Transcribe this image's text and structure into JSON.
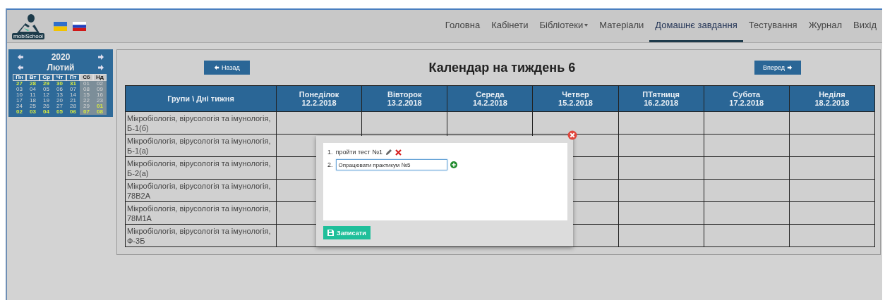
{
  "header": {
    "logo_text": "mobiSchool",
    "nav": [
      {
        "label": "Головна",
        "selected": false,
        "dropdown": false
      },
      {
        "label": "Кабінети",
        "selected": false,
        "dropdown": false
      },
      {
        "label": "Бібліотеки",
        "selected": false,
        "dropdown": true
      },
      {
        "label": "Матеріали",
        "selected": false,
        "dropdown": false
      },
      {
        "label": "Домашнє завдання",
        "selected": true,
        "dropdown": false
      },
      {
        "label": "Тестування",
        "selected": false,
        "dropdown": false
      },
      {
        "label": "Журнал",
        "selected": false,
        "dropdown": false
      },
      {
        "label": "Вихід",
        "selected": false,
        "dropdown": false
      }
    ]
  },
  "mini_calendar": {
    "year": "2020",
    "month": "Лютий",
    "weekdays": [
      {
        "label": "Пн",
        "weekend": false
      },
      {
        "label": "Вт",
        "weekend": false
      },
      {
        "label": "Ср",
        "weekend": false
      },
      {
        "label": "Чт",
        "weekend": false
      },
      {
        "label": "Пт",
        "weekend": false
      },
      {
        "label": "Сб",
        "weekend": true
      },
      {
        "label": "Нд",
        "weekend": true
      }
    ],
    "weeks": [
      [
        {
          "day": "27",
          "other_month": true
        },
        {
          "day": "28",
          "other_month": true
        },
        {
          "day": "29",
          "other_month": true
        },
        {
          "day": "30",
          "other_month": true
        },
        {
          "day": "31",
          "other_month": true
        },
        {
          "day": "01",
          "other_month": false
        },
        {
          "day": "02",
          "other_month": false
        }
      ],
      [
        {
          "day": "03",
          "other_month": false
        },
        {
          "day": "04",
          "other_month": false
        },
        {
          "day": "05",
          "other_month": false
        },
        {
          "day": "06",
          "other_month": false
        },
        {
          "day": "07",
          "other_month": false
        },
        {
          "day": "08",
          "other_month": false
        },
        {
          "day": "09",
          "other_month": false
        }
      ],
      [
        {
          "day": "10",
          "other_month": false
        },
        {
          "day": "11",
          "other_month": false
        },
        {
          "day": "12",
          "other_month": false
        },
        {
          "day": "13",
          "other_month": false
        },
        {
          "day": "14",
          "other_month": false
        },
        {
          "day": "15",
          "other_month": false
        },
        {
          "day": "16",
          "other_month": false
        }
      ],
      [
        {
          "day": "17",
          "other_month": false
        },
        {
          "day": "18",
          "other_month": false
        },
        {
          "day": "19",
          "other_month": false
        },
        {
          "day": "20",
          "other_month": false
        },
        {
          "day": "21",
          "other_month": false
        },
        {
          "day": "22",
          "other_month": false
        },
        {
          "day": "23",
          "other_month": false
        }
      ],
      [
        {
          "day": "24",
          "other_month": false
        },
        {
          "day": "25",
          "other_month": false
        },
        {
          "day": "26",
          "other_month": false
        },
        {
          "day": "27",
          "other_month": false
        },
        {
          "day": "28",
          "other_month": false
        },
        {
          "day": "29",
          "other_month": false
        },
        {
          "day": "01",
          "other_month": true
        }
      ],
      [
        {
          "day": "02",
          "other_month": true
        },
        {
          "day": "03",
          "other_month": true
        },
        {
          "day": "04",
          "other_month": true
        },
        {
          "day": "05",
          "other_month": true
        },
        {
          "day": "06",
          "other_month": true
        },
        {
          "day": "07",
          "other_month": true
        },
        {
          "day": "08",
          "other_month": true
        }
      ]
    ]
  },
  "week": {
    "back_button": "Назад",
    "title": "Календар на тиждень 6",
    "forward_button": "Вперед",
    "table": {
      "corner_heading": "Групи \\ Дні тижня",
      "columns": [
        {
          "day": "Понеділок",
          "date": "12.2.2018"
        },
        {
          "day": "Вівторок",
          "date": "13.2.2018"
        },
        {
          "day": "Середа",
          "date": "14.2.2018"
        },
        {
          "day": "Четвер",
          "date": "15.2.2018"
        },
        {
          "day": "ПТятниця",
          "date": "16.2.2018"
        },
        {
          "day": "Субота",
          "date": "17.2.2018"
        },
        {
          "day": "Неділя",
          "date": "18.2.2018"
        }
      ],
      "rows": [
        {
          "group": "Мікробіологія, вірусологія та імунологія, Б-1(б)"
        },
        {
          "group": "Мікробіологія, вірусологія та імунологія, Б-1(а)"
        },
        {
          "group": "Мікробіологія, вірусологія та імунологія, Б-2(а)"
        },
        {
          "group": "Мікробіологія, вірусологія та імунологія, 78В2А"
        },
        {
          "group": "Мікробіологія, вірусологія та імунологія, 78М1А"
        },
        {
          "group": "Мікробіологія, вірусологія та імунологія, Ф-3Б"
        }
      ]
    }
  },
  "homework_dialog": {
    "items": [
      {
        "kind": "entry",
        "number": "1.",
        "text": "пройти тест №1"
      },
      {
        "kind": "input",
        "number": "2.",
        "value": "Опрацювати практикум №5"
      }
    ],
    "save_button": "Записати"
  }
}
